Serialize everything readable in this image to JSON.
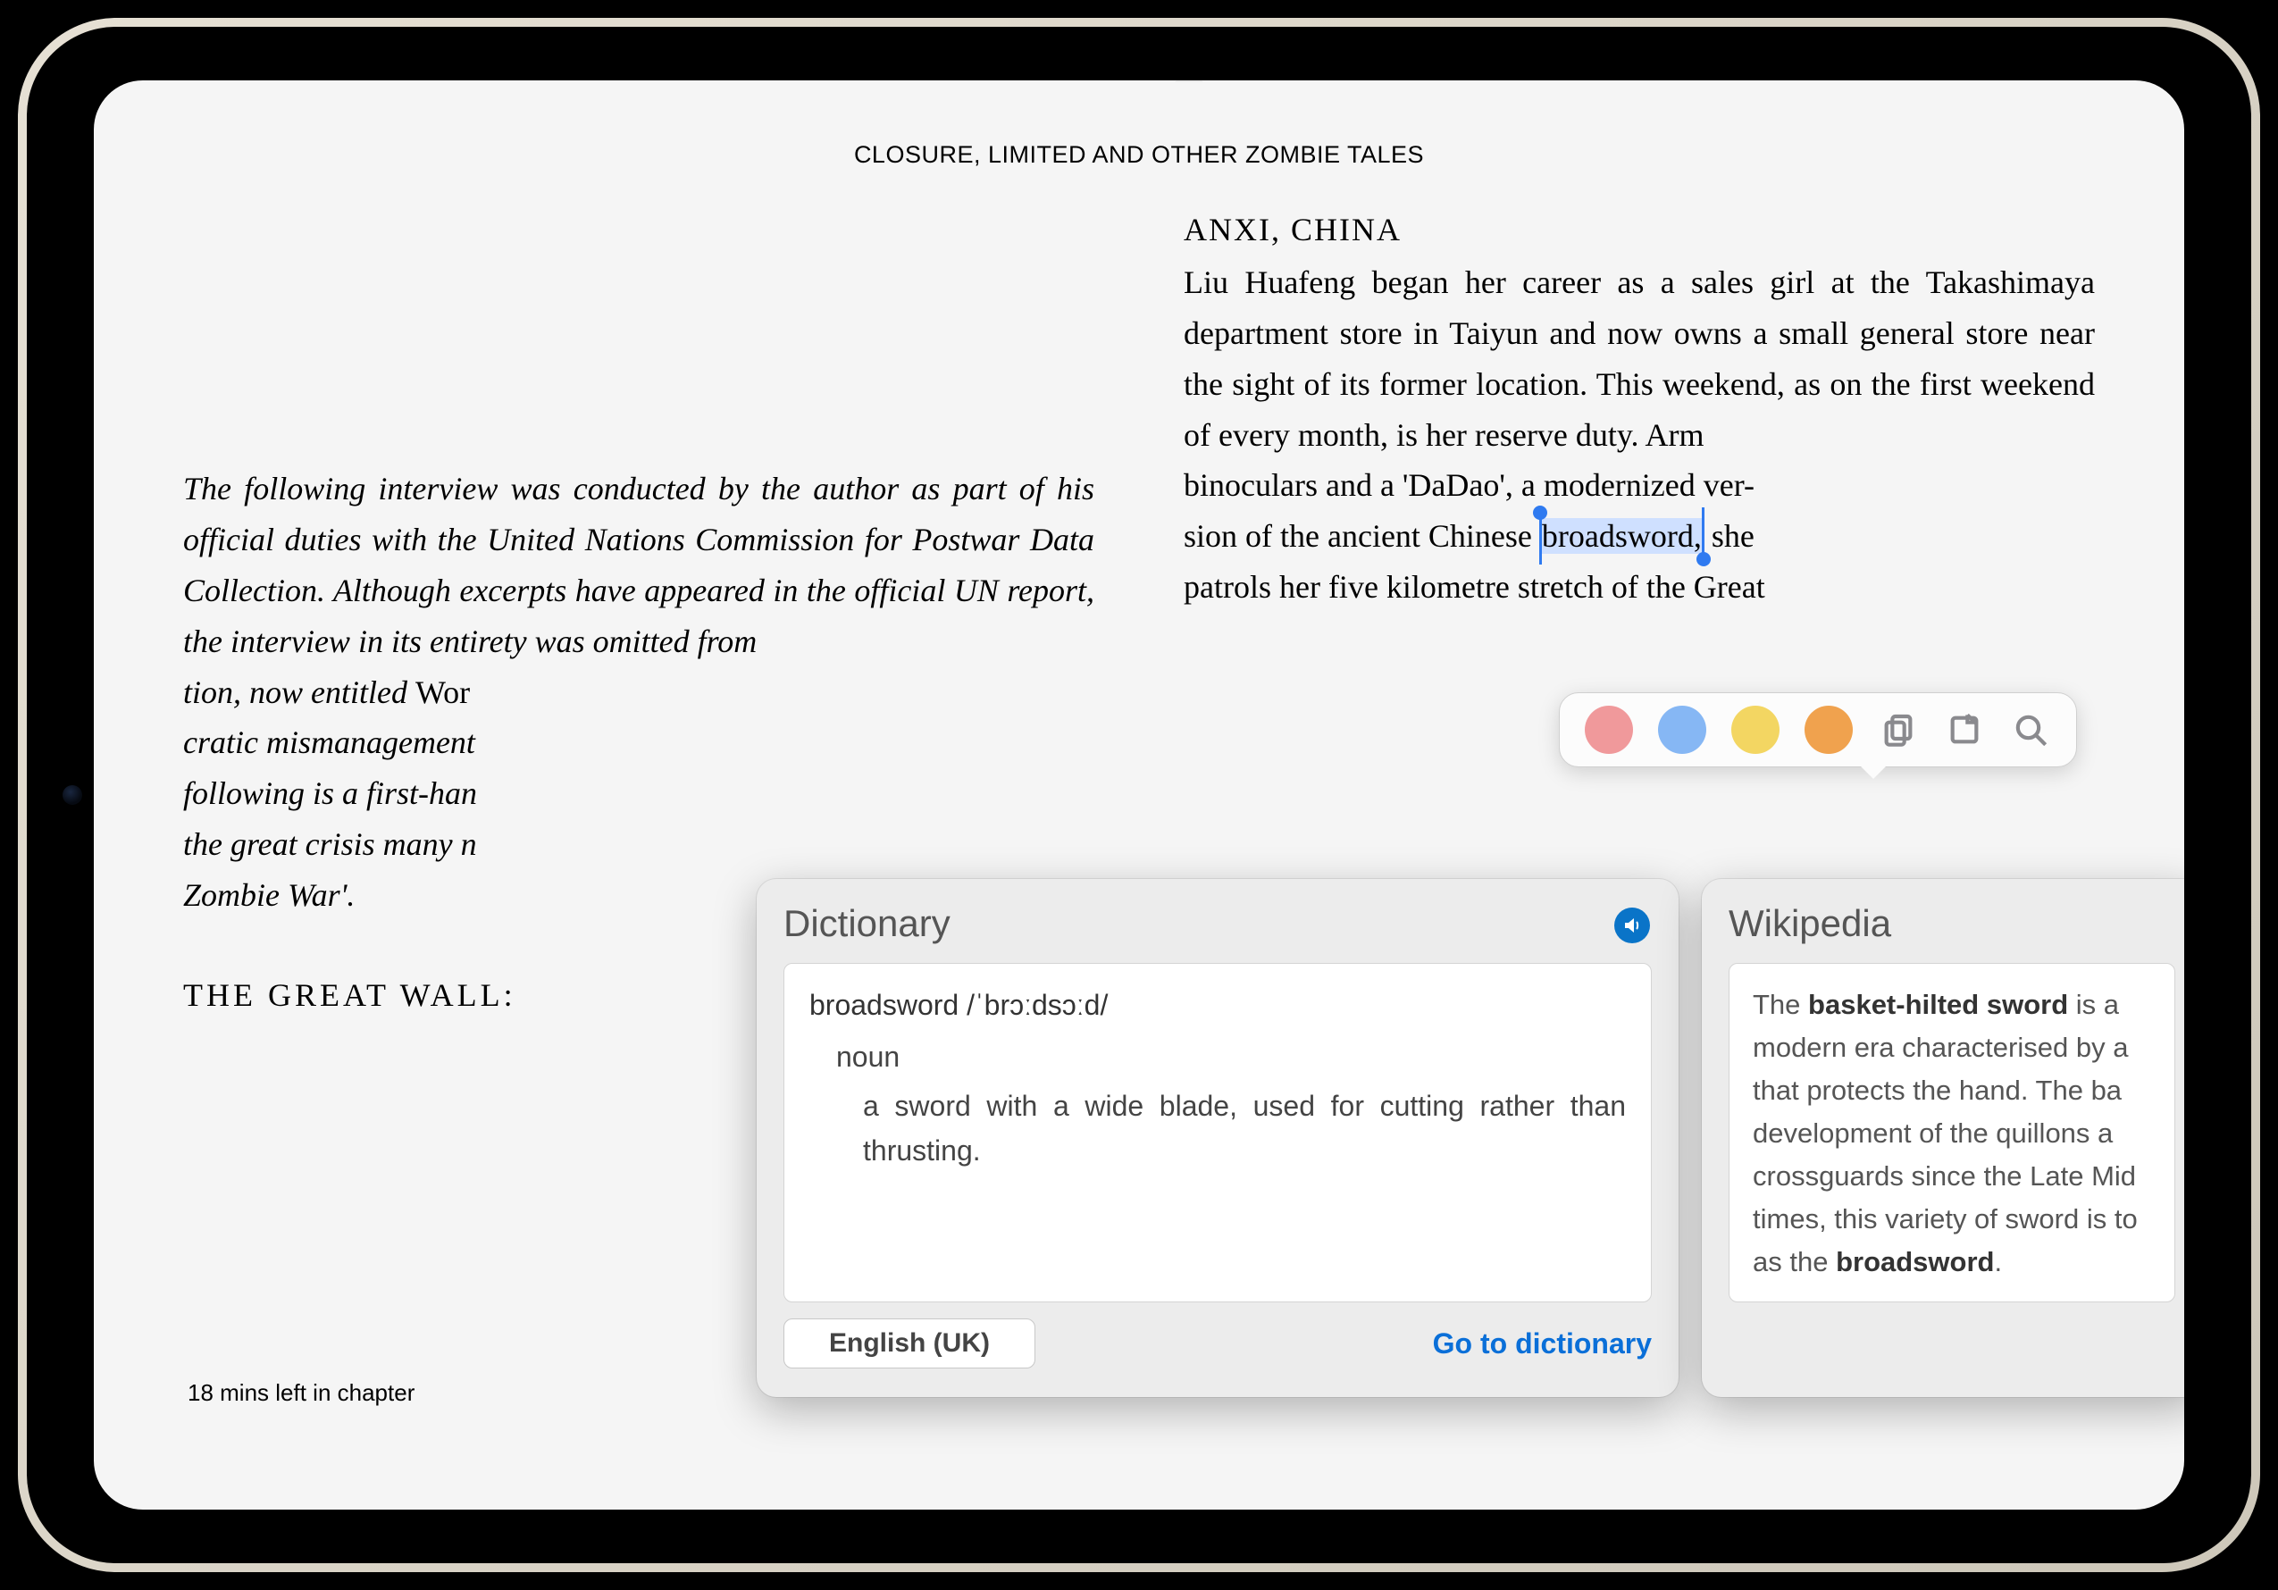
{
  "header": {
    "title": "CLOSURE, LIMITED AND OTHER ZOMBIE TALES"
  },
  "left_column": {
    "intro": "The following interview was conducted by the author as part of his official duties with the United Nations Commission for Postwar Data Collection. Although excerpts have appeared in the official UN report, the interview in its entirety was omitted from",
    "intro_tail": "tion, now entitled",
    "intro_tail2": "cratic mismanagement",
    "intro_tail3": "following is a first-han",
    "intro_tail4": "the great crisis many n",
    "intro_tail5": "Zombie War'.",
    "book_ref": "Wor",
    "section": "THE GREAT WALL:"
  },
  "right_column": {
    "location": "ANXI, CHINA",
    "p1a": "Liu Huafeng began her career as a sales girl at the Takashimaya department store in Taiyun and now owns a small general store near the sight of its former location. This weekend, as on the first weekend of every month, is her reserve duty. Arm",
    "p1b": "binoculars and a 'DaDao', a modernized ver-",
    "p1c": "sion of the ancient Chinese ",
    "selected_word": "broadsword,",
    "p1d": " she",
    "p1e": "patrols her five kilometre stretch of the Great"
  },
  "reading_time": "18 mins left in chapter",
  "toolbar": {
    "colors": [
      "pink",
      "blue",
      "yellow",
      "orange"
    ],
    "icons": {
      "copy": "copy-icon",
      "note": "note-icon",
      "search": "search-icon"
    }
  },
  "dictionary": {
    "title": "Dictionary",
    "headword": "broadsword /ˈbrɔːdsɔːd/",
    "pos": "noun",
    "definition": "a sword with a wide blade, used for cutting rather than thrusting.",
    "language_button": "English (UK)",
    "goto": "Go to dictionary"
  },
  "wikipedia": {
    "title": "Wikipedia",
    "snippet_pre": "The ",
    "snippet_bold": "basket-hilted sword",
    "snippet_mid": " is a modern era characterised by a that protects the hand. The ba development of the quillons a crossguards since the Late Mid times, this variety of sword is to as the ",
    "snippet_bold2": "broadsword",
    "snippet_end": "."
  }
}
